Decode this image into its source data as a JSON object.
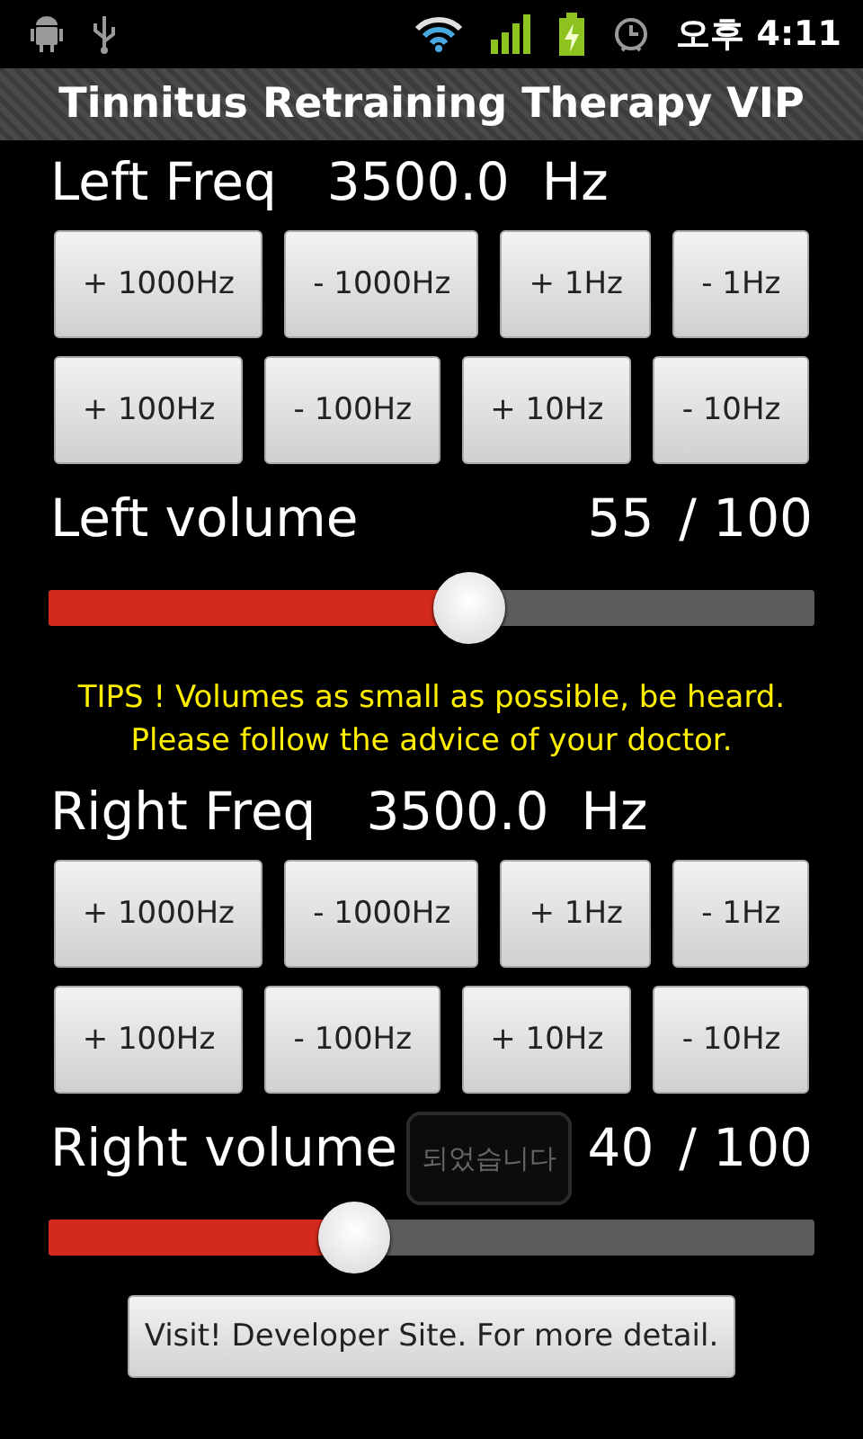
{
  "status_bar": {
    "time": "오후 4:11"
  },
  "window": {
    "title": "Tinnitus Retraining Therapy VIP"
  },
  "channels": [
    {
      "freq_label": "Left Freq",
      "freq": "3500.0",
      "unit": "Hz",
      "button_rows": [
        [
          "+ 1000Hz",
          "- 1000Hz",
          "+ 1Hz",
          "- 1Hz"
        ],
        [
          "+ 100Hz",
          "- 100Hz",
          "+ 10Hz",
          "- 10Hz"
        ]
      ],
      "volume_label": "Left volume",
      "volume_value": "55",
      "volume_max": "/ 100",
      "level": 0.55
    },
    {
      "freq_label": "Right Freq",
      "freq": "3500.0",
      "unit": "Hz",
      "button_rows": [
        [
          "+ 1000Hz",
          "- 1000Hz",
          "+ 1Hz",
          "- 1Hz"
        ],
        [
          "+ 100Hz",
          "- 100Hz",
          "+ 10Hz",
          "- 10Hz"
        ]
      ],
      "volume_label": "Right volume",
      "volume_value": "40",
      "volume_max": "/ 100",
      "level": 0.4
    }
  ],
  "tips": [
    "TIPS ! Volumes as small as possible, be heard.",
    "Please follow the advice of your doctor."
  ],
  "toast": "되었습니다",
  "footer_button": "Visit! Developer Site. For more detail."
}
